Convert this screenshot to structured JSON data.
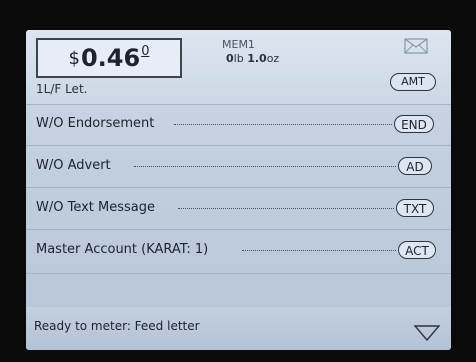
{
  "postage": {
    "currency": "$",
    "value": "0.46",
    "tenth": "0"
  },
  "mail_class": "1L/F Let.",
  "memory": "MEM1",
  "weight": {
    "lb": "0",
    "lb_unit": "lb",
    "oz": "1.0",
    "oz_unit": "oz"
  },
  "amt_button": "AMT",
  "options": [
    {
      "label": "W/O Endorsement",
      "button": "END"
    },
    {
      "label": "W/O Advert",
      "button": "AD"
    },
    {
      "label": "W/O Text Message",
      "button": "TXT"
    },
    {
      "label": "Master Account (KARAT: 1)",
      "button": "ACT"
    }
  ],
  "status": "Ready to meter: Feed letter",
  "icons": {
    "mail": "envelope-icon",
    "down": "triangle-down-icon"
  }
}
